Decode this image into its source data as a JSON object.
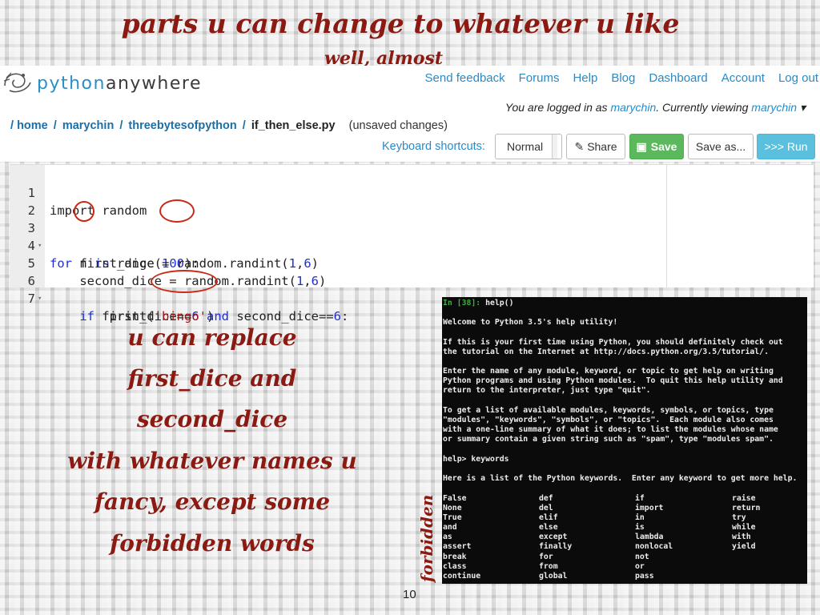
{
  "slide": {
    "title": "parts u can change to whatever u like",
    "subtitle": "well, almost",
    "page_number": "10",
    "annotation_lines": [
      "u can replace",
      "first_dice and",
      "second_dice",
      "with whatever names u",
      "fancy, except some",
      "forbidden words"
    ],
    "forbidden_label": "forbidden"
  },
  "header": {
    "logo_py": "python",
    "logo_rest": "anywhere",
    "nav": [
      "Send feedback",
      "Forums",
      "Help",
      "Blog",
      "Dashboard",
      "Account",
      "Log out"
    ],
    "login_prefix": "You are logged in as ",
    "user": "marychin",
    "login_mid": ". Currently viewing ",
    "viewing_user": "marychin",
    "caret": "▾"
  },
  "breadcrumb": {
    "root": "/",
    "home": "home",
    "user": "marychin",
    "folder": "threebytesofpython",
    "file": "if_then_else.py",
    "status": "(unsaved changes)"
  },
  "toolbar": {
    "shortcuts_label": "Keyboard shortcuts:",
    "mode": "Normal",
    "share": "Share",
    "save": "Save",
    "save_as": "Save as...",
    "run": ">>> Run"
  },
  "editor": {
    "line_numbers": [
      "1",
      "2",
      "3",
      "4",
      "5",
      "6",
      "7"
    ]
  },
  "terminal": {
    "prompt": "In [38]:",
    "command": " help()",
    "lines": [
      "Welcome to Python 3.5's help utility!",
      "If this is your first time using Python, you should definitely check out",
      "the tutorial on the Internet at http://docs.python.org/3.5/tutorial/.",
      "Enter the name of any module, keyword, or topic to get help on writing",
      "Python programs and using Python modules.  To quit this help utility and",
      "return to the interpreter, just type \"quit\".",
      "To get a list of available modules, keywords, symbols, or topics, type",
      "\"modules\", \"keywords\", \"symbols\", or \"topics\".  Each module also comes",
      "with a one-line summary of what it does; to list the modules whose name",
      "or summary contain a given string such as \"spam\", type \"modules spam\".",
      "help> keywords",
      "Here is a list of the Python keywords.  Enter any keyword to get more help."
    ],
    "keywords": [
      [
        "False",
        "None",
        "True",
        "and",
        "as",
        "assert",
        "break",
        "class",
        "continue"
      ],
      [
        "def",
        "del",
        "elif",
        "else",
        "except",
        "finally",
        "for",
        "from",
        "global"
      ],
      [
        "if",
        "import",
        "in",
        "is",
        "lambda",
        "nonlocal",
        "not",
        "or",
        "pass"
      ],
      [
        "raise",
        "return",
        "try",
        "while",
        "with",
        "yield"
      ]
    ]
  },
  "colors": {
    "accent_link": "#2a8ac6",
    "save_green": "#5cb85c",
    "run_blue": "#5bc0de",
    "annotation_red": "#8b1a12"
  }
}
